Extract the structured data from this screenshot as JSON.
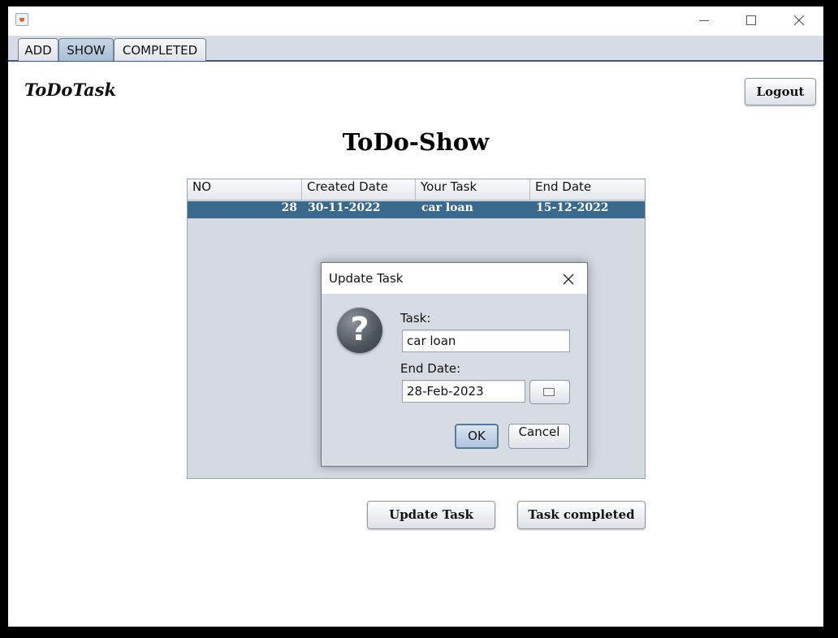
{
  "window": {
    "title": ""
  },
  "tabs": [
    {
      "label": "ADD"
    },
    {
      "label": "SHOW"
    },
    {
      "label": "COMPLETED"
    }
  ],
  "header": {
    "app_title": "ToDoTask",
    "logout_label": "Logout"
  },
  "page": {
    "heading": "ToDo-Show"
  },
  "table": {
    "columns": [
      "NO",
      "Created Date",
      "Your Task",
      "End Date"
    ],
    "rows": [
      {
        "no": "28",
        "created": "30-11-2022",
        "task": "car loan",
        "end": "15-12-2022",
        "selected": true
      }
    ]
  },
  "actions": {
    "update_label": "Update Task",
    "completed_label": "Task completed"
  },
  "dialog": {
    "title": "Update Task",
    "icon": "question-icon",
    "task_label": "Task:",
    "task_value": "car loan",
    "end_label": "End Date:",
    "end_value": "28-Feb-2023",
    "ok_label": "OK",
    "cancel_label": "Cancel"
  },
  "colors": {
    "selection": "#39698c",
    "tab_active": "#a9bfd6",
    "panel": "#d5d9e0"
  }
}
